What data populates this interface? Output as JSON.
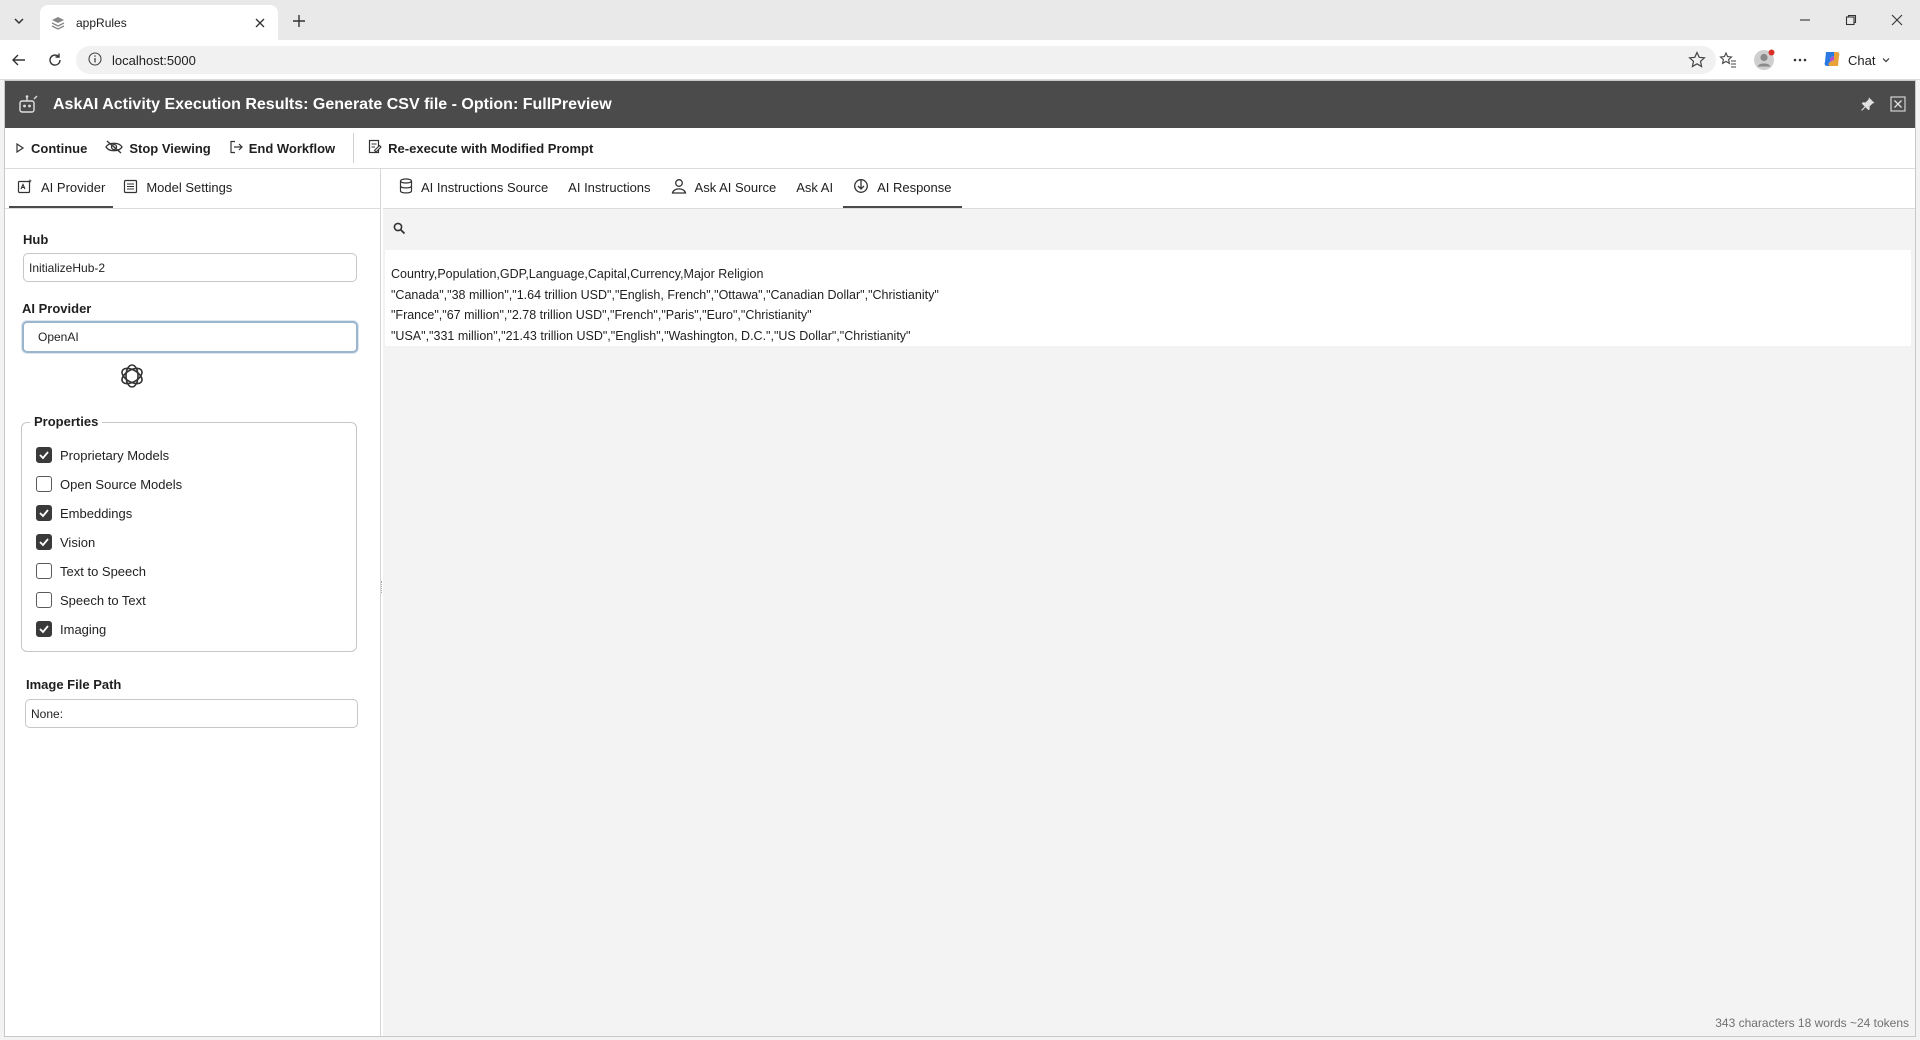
{
  "browser": {
    "tab_title": "appRules",
    "url": "localhost:5000",
    "chat_label": "Chat"
  },
  "app": {
    "title": "AskAI Activity Execution Results: Generate CSV file - Option: FullPreview"
  },
  "toolbar": {
    "continue_label": "Continue",
    "stop_viewing_label": "Stop Viewing",
    "end_workflow_label": "End Workflow",
    "reexecute_label": "Re-execute with Modified Prompt"
  },
  "left_tabs": {
    "ai_provider": "AI Provider",
    "model_settings": "Model Settings"
  },
  "form": {
    "hub_label": "Hub",
    "hub_value": "InitializeHub-2",
    "provider_label": "AI Provider",
    "provider_value": "OpenAI",
    "properties_label": "Properties",
    "properties": [
      {
        "label": "Proprietary Models",
        "checked": true
      },
      {
        "label": "Open Source Models",
        "checked": false
      },
      {
        "label": "Embeddings",
        "checked": true
      },
      {
        "label": "Vision",
        "checked": true
      },
      {
        "label": "Text to Speech",
        "checked": false
      },
      {
        "label": "Speech to Text",
        "checked": false
      },
      {
        "label": "Imaging",
        "checked": true
      }
    ],
    "image_path_label": "Image File Path",
    "image_path_value": "None:"
  },
  "right_tabs": {
    "instructions_source": "AI Instructions Source",
    "instructions": "AI Instructions",
    "ask_ai_source": "Ask AI Source",
    "ask_ai": "Ask AI",
    "ai_response": "AI Response"
  },
  "response_lines": [
    "Country,Population,GDP,Language,Capital,Currency,Major Religion",
    "\"Canada\",\"38 million\",\"1.64 trillion USD\",\"English, French\",\"Ottawa\",\"Canadian Dollar\",\"Christianity\"",
    "\"France\",\"67 million\",\"2.78 trillion USD\",\"French\",\"Paris\",\"Euro\",\"Christianity\"",
    "\"USA\",\"331 million\",\"21.43 trillion USD\",\"English\",\"Washington, D.C.\",\"US Dollar\",\"Christianity\""
  ],
  "stats": "343 characters 18 words ~24 tokens",
  "colors": {
    "titlebar": "#4b4b4b",
    "checkbox_checked": "#3a3a3a",
    "focus_border": "#9bb6cc"
  }
}
